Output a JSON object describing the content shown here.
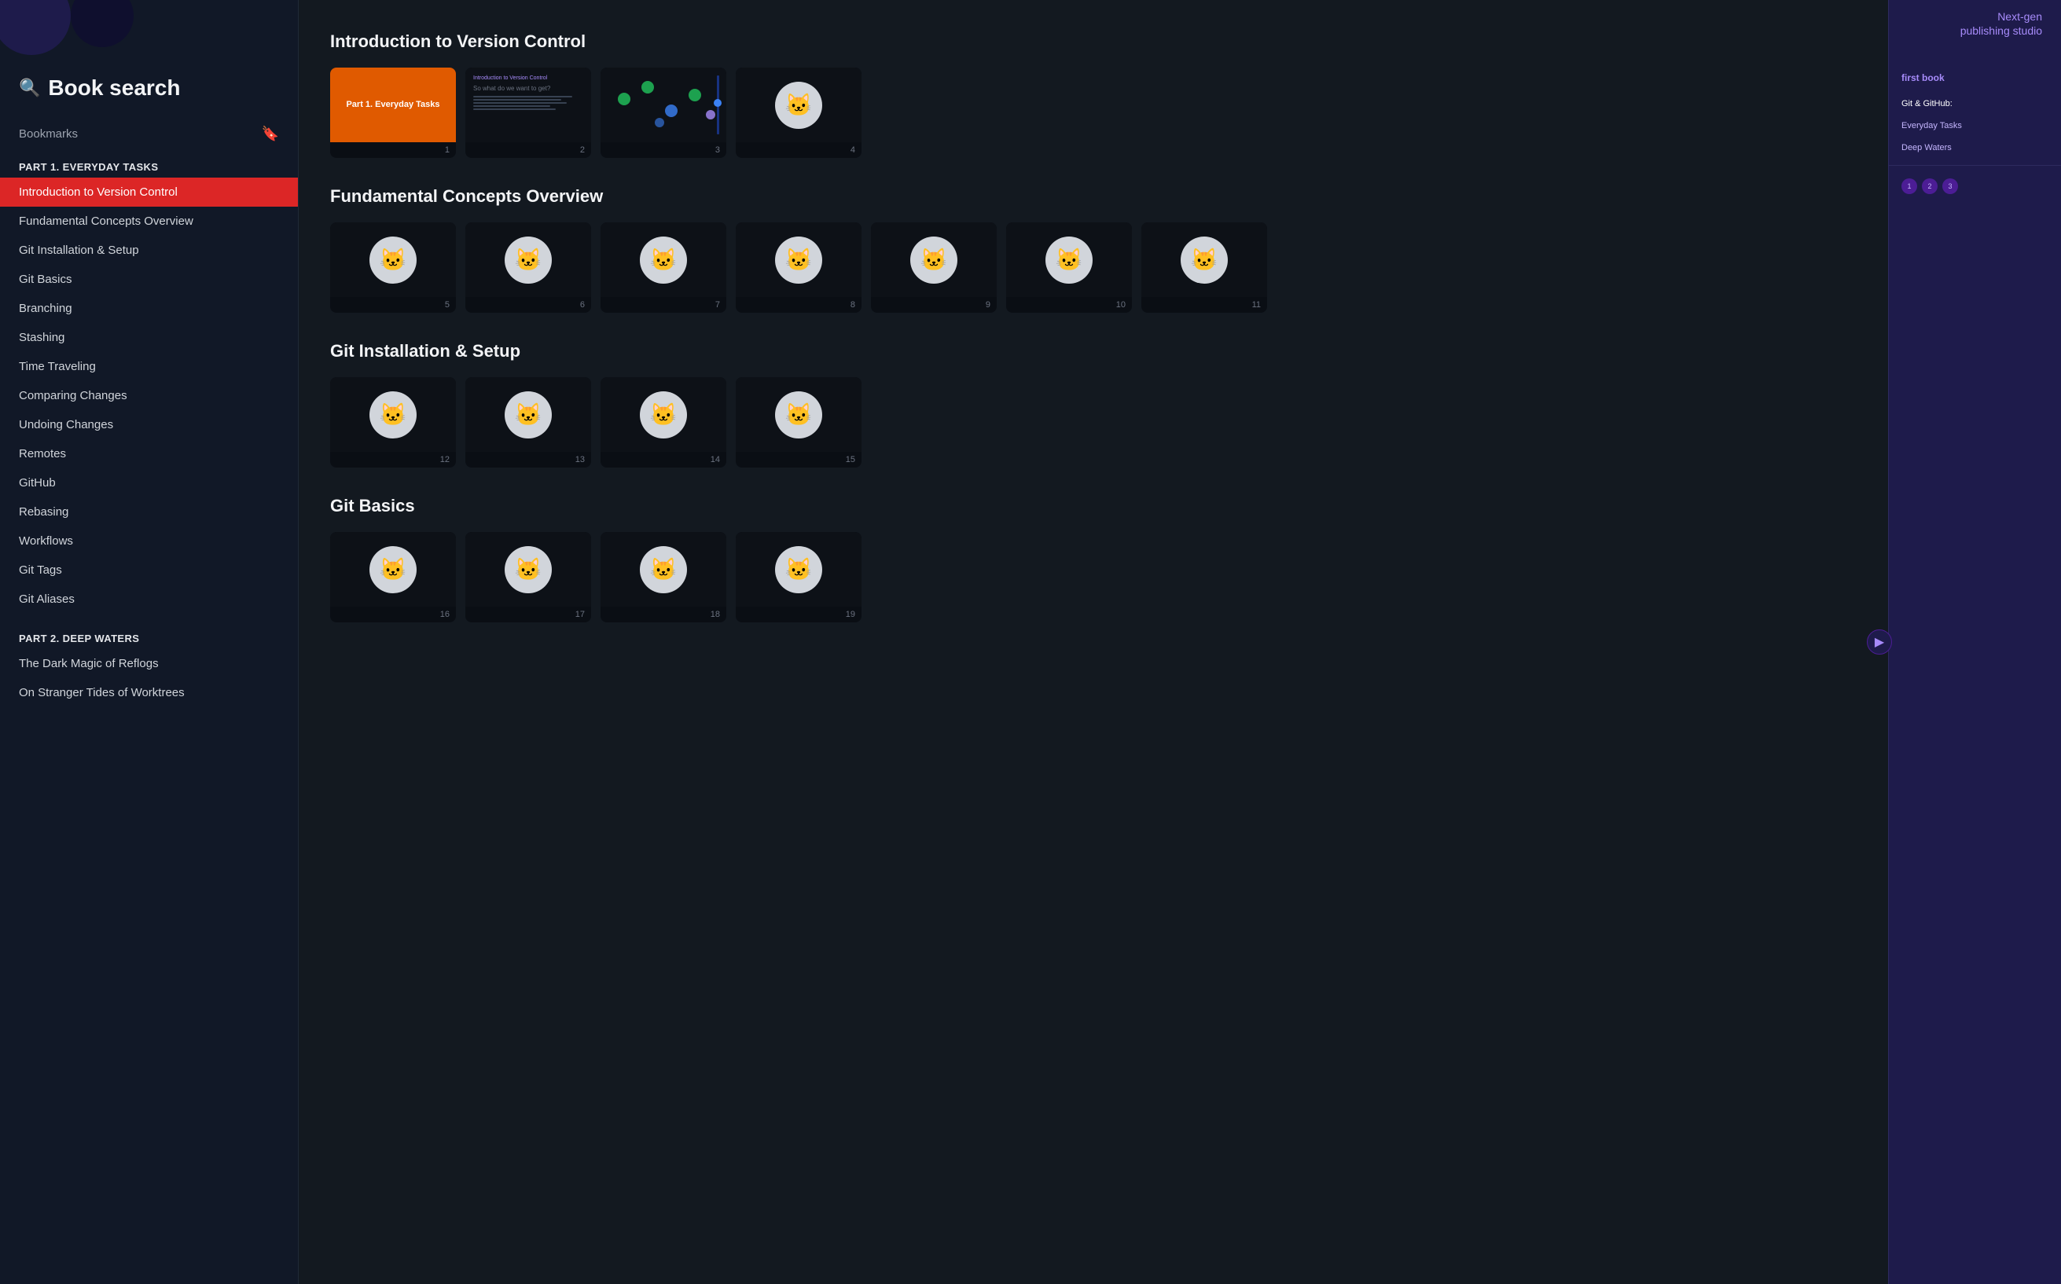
{
  "header": {
    "search_label": "Book search",
    "search_icon": "🔍"
  },
  "top_right": {
    "line1": "Next-gen",
    "line2": "publishing studio"
  },
  "sidebar": {
    "bookmarks_label": "Bookmarks",
    "part1_label": "PART 1. EVERYDAY TASKS",
    "part2_label": "PART 2. DEEP WATERS",
    "part1_items": [
      {
        "id": "intro-version-control",
        "label": "Introduction to Version Control",
        "active": true
      },
      {
        "id": "fundamental-concepts",
        "label": "Fundamental Concepts Overview",
        "active": false
      },
      {
        "id": "git-installation",
        "label": "Git Installation & Setup",
        "active": false
      },
      {
        "id": "git-basics",
        "label": "Git Basics",
        "active": false
      },
      {
        "id": "branching",
        "label": "Branching",
        "active": false
      },
      {
        "id": "stashing",
        "label": "Stashing",
        "active": false
      },
      {
        "id": "time-traveling",
        "label": "Time Traveling",
        "active": false
      },
      {
        "id": "comparing-changes",
        "label": "Comparing Changes",
        "active": false
      },
      {
        "id": "undoing-changes",
        "label": "Undoing Changes",
        "active": false
      },
      {
        "id": "remotes",
        "label": "Remotes",
        "active": false
      },
      {
        "id": "github",
        "label": "GitHub",
        "active": false
      },
      {
        "id": "rebasing",
        "label": "Rebasing",
        "active": false
      },
      {
        "id": "workflows",
        "label": "Workflows",
        "active": false
      },
      {
        "id": "git-tags",
        "label": "Git Tags",
        "active": false
      },
      {
        "id": "git-aliases",
        "label": "Git Aliases",
        "active": false
      }
    ],
    "part2_items": [
      {
        "id": "dark-magic-reflogs",
        "label": "The Dark Magic of Reflogs",
        "active": false
      },
      {
        "id": "on-stranger-tides",
        "label": "On Stranger Tides of Worktrees",
        "active": false
      }
    ]
  },
  "main": {
    "sections": [
      {
        "id": "intro-version-control",
        "title": "Introduction to Version Control",
        "slides": [
          {
            "num": 1,
            "type": "orange",
            "text": "Part 1. Everyday Tasks"
          },
          {
            "num": 2,
            "type": "text",
            "subtitle": "Introduction to Version Control"
          },
          {
            "num": 3,
            "type": "dots"
          },
          {
            "num": 4,
            "type": "cat"
          }
        ]
      },
      {
        "id": "fundamental-concepts",
        "title": "Fundamental Concepts Overview",
        "slides": [
          {
            "num": 5,
            "type": "cat"
          },
          {
            "num": 6,
            "type": "cat"
          },
          {
            "num": 7,
            "type": "cat"
          },
          {
            "num": 8,
            "type": "cat"
          },
          {
            "num": 9,
            "type": "cat"
          },
          {
            "num": 10,
            "type": "cat"
          },
          {
            "num": 11,
            "type": "cat"
          }
        ]
      },
      {
        "id": "git-installation",
        "title": "Git Installation & Setup",
        "slides": [
          {
            "num": 12,
            "type": "cat"
          },
          {
            "num": 13,
            "type": "cat"
          },
          {
            "num": 14,
            "type": "cat"
          },
          {
            "num": 15,
            "type": "cat"
          }
        ]
      },
      {
        "id": "git-basics",
        "title": "Git Basics",
        "slides": [
          {
            "num": 16,
            "type": "cat"
          },
          {
            "num": 17,
            "type": "cat"
          },
          {
            "num": 18,
            "type": "cat"
          },
          {
            "num": 19,
            "type": "cat"
          }
        ]
      }
    ]
  },
  "right_panel": {
    "header": "first book",
    "items": [
      {
        "label": "Git & GitHub:",
        "sub": true
      },
      {
        "label": "Everyday Tasks",
        "sub": true
      },
      {
        "label": "Deep Waters",
        "sub": true
      }
    ],
    "badges": [
      "1",
      "2",
      "3"
    ]
  },
  "panel_arrow": "▶"
}
